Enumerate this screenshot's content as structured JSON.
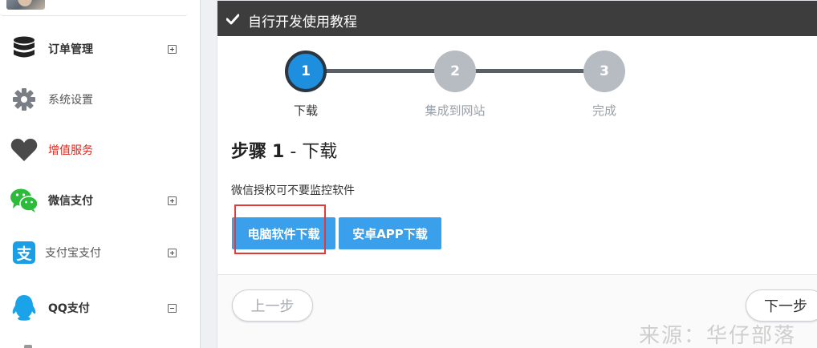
{
  "sidebar": {
    "items": [
      {
        "label": "订单管理",
        "icon": "database-icon",
        "expanded": false
      },
      {
        "label": "系统设置",
        "icon": "gear-icon"
      },
      {
        "label": "增值服务",
        "icon": "heart-icon",
        "color": "#e0251b"
      },
      {
        "label": "微信支付",
        "icon": "wechat-icon",
        "expanded": false
      },
      {
        "label": "支付宝支付",
        "icon": "alipay-icon",
        "expanded": false
      },
      {
        "label": "QQ支付",
        "icon": "qq-penguin-icon",
        "expanded": true
      }
    ]
  },
  "panel": {
    "title": "自行开发使用教程",
    "steps": [
      {
        "number": "1",
        "label": "下载",
        "active": true
      },
      {
        "number": "2",
        "label": "集成到网站",
        "active": false
      },
      {
        "number": "3",
        "label": "完成",
        "active": false
      }
    ],
    "heading_prefix": "步骤",
    "heading_number": "1",
    "heading_suffix": "- 下载",
    "description": "微信授权可不要监控软件",
    "buttons": {
      "pc_download": "电脑软件下载",
      "android_download": "安卓APP下载"
    },
    "footer": {
      "prev": "上一步",
      "next": "下一步"
    }
  },
  "watermark": "来源：华仔部落",
  "colors": {
    "header_bg": "#3d3d3d",
    "step_active": "#1e8fde",
    "step_inactive": "#b7bcc2",
    "button_blue": "#3aa0ec",
    "highlight_red": "#e53935",
    "value_added_red": "#e0251b"
  }
}
